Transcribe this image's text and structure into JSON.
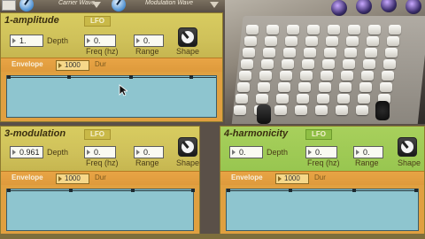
{
  "topbar": {
    "carrier_label": "Carrier Wave",
    "modulation_label": "Modulation Wave"
  },
  "panels": {
    "amplitude": {
      "title": "1-amplitude",
      "lfo": "LFO",
      "depth_value": "1.",
      "depth_label": "Depth",
      "freq_value": "0.",
      "freq_label": "Freq (hz)",
      "range_value": "0.",
      "range_label": "Range",
      "shape_label": "Shape",
      "envelope_label": "Envelope",
      "dur_value": "1000",
      "dur_label": "Dur"
    },
    "modulation": {
      "title": "3-modulation",
      "lfo": "LFO",
      "depth_value": "0.961",
      "depth_label": "Depth",
      "freq_value": "0.",
      "freq_label": "Freq (hz)",
      "range_value": "0.",
      "range_label": "Range",
      "shape_label": "Shape",
      "envelope_label": "Envelope",
      "dur_value": "1000",
      "dur_label": "Dur"
    },
    "harmonicity": {
      "title": "4-harmonicity",
      "lfo": "LFO",
      "depth_value": "0.",
      "depth_label": "Depth",
      "freq_value": "0.",
      "freq_label": "Freq (hz)",
      "range_value": "0.",
      "range_label": "Range",
      "shape_label": "Shape",
      "envelope_label": "Envelope",
      "dur_value": "1000",
      "dur_label": "Dur"
    }
  },
  "colors": {
    "panel_yellow": "#d0c35a",
    "panel_green": "#a0cc55",
    "envelope_orange": "#e0a040",
    "envelope_canvas": "#8ec5cf"
  },
  "icons": [
    "wave-selector-icon",
    "dropdown-arrow-icon",
    "shape-dial-icon",
    "mouse-cursor-icon"
  ]
}
